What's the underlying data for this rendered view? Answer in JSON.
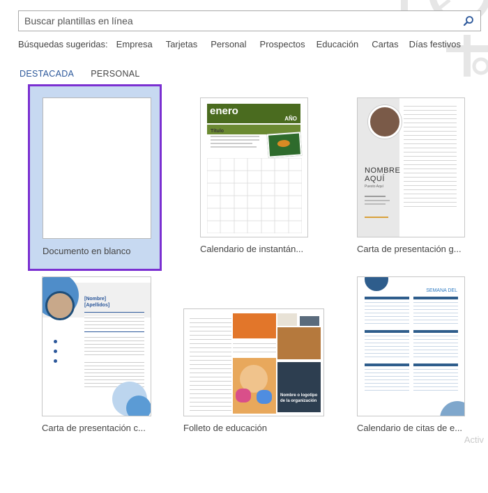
{
  "search": {
    "placeholder": "Buscar plantillas en línea"
  },
  "suggested": {
    "label": "Búsquedas sugeridas:",
    "items": [
      "Empresa",
      "Tarjetas",
      "Personal",
      "Prospectos",
      "Educación",
      "Cartas",
      "Días festivos"
    ]
  },
  "tabs": [
    {
      "label": "DESTACADA"
    },
    {
      "label": "PERSONAL"
    }
  ],
  "templates": [
    {
      "caption": "Documento en blanco"
    },
    {
      "caption": "Calendario de instantán..."
    },
    {
      "caption": "Carta de presentación g..."
    },
    {
      "caption": "Carta de presentación c..."
    },
    {
      "caption": "Folleto de educación"
    },
    {
      "caption": "Calendario de citas de e..."
    }
  ],
  "thumb_text": {
    "cal_month": "enero",
    "cal_year": "AÑO",
    "cal_title": "Título",
    "letter_name": "NOMBRE",
    "letter_name2": "AQUÍ",
    "letter_sub": "Puesto Aquí",
    "resume_name": "[Nombre]",
    "resume_last": "[Apellidos]",
    "brochure_title": "Nombre o logotipo de la organización",
    "appt_title": "SEMANA DEL"
  },
  "watermark": "Activ",
  "colors": {
    "accent": "#2b579a",
    "selection_border": "#7a2fd1",
    "selection_fill": "#c7d9f1"
  }
}
